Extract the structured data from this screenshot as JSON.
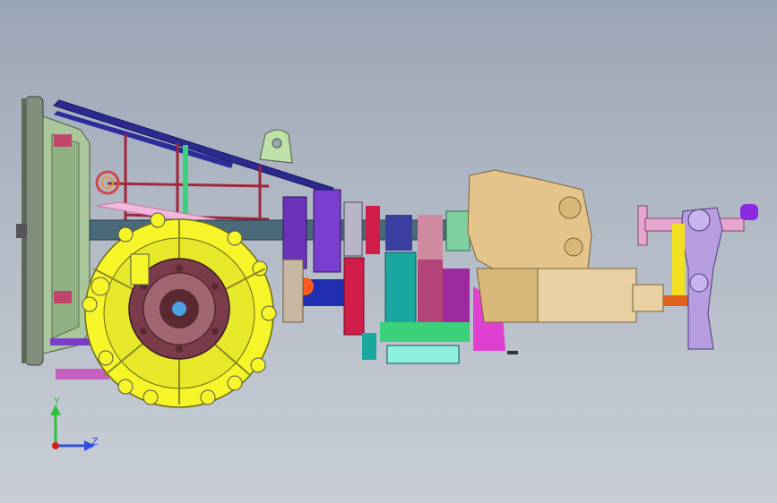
{
  "viewport": {
    "background_top": "#9aa5b5",
    "background_bottom": "#c9ced6"
  },
  "model": {
    "colors": {
      "flywheel": "#7f8f7c",
      "clutch": "#a9c79a",
      "housing": "#f5f52a",
      "hub": "#7a3b4a",
      "rail": "#2a2a8f",
      "frame": "#a0263a",
      "gear_purple": "#6b34b8",
      "gear_red": "#d11d49",
      "gear_teal": "#1aa7a0",
      "gear_green": "#3ad17a",
      "transfer_case": "#e4c48a",
      "bracket": "#b89ce0",
      "pink": "#d65ad0"
    }
  },
  "triad": {
    "y_label": "Y",
    "z_label": "Z",
    "y_color": "#2fbf3a",
    "z_color": "#2f4fe0",
    "x_color": "#d02020"
  }
}
